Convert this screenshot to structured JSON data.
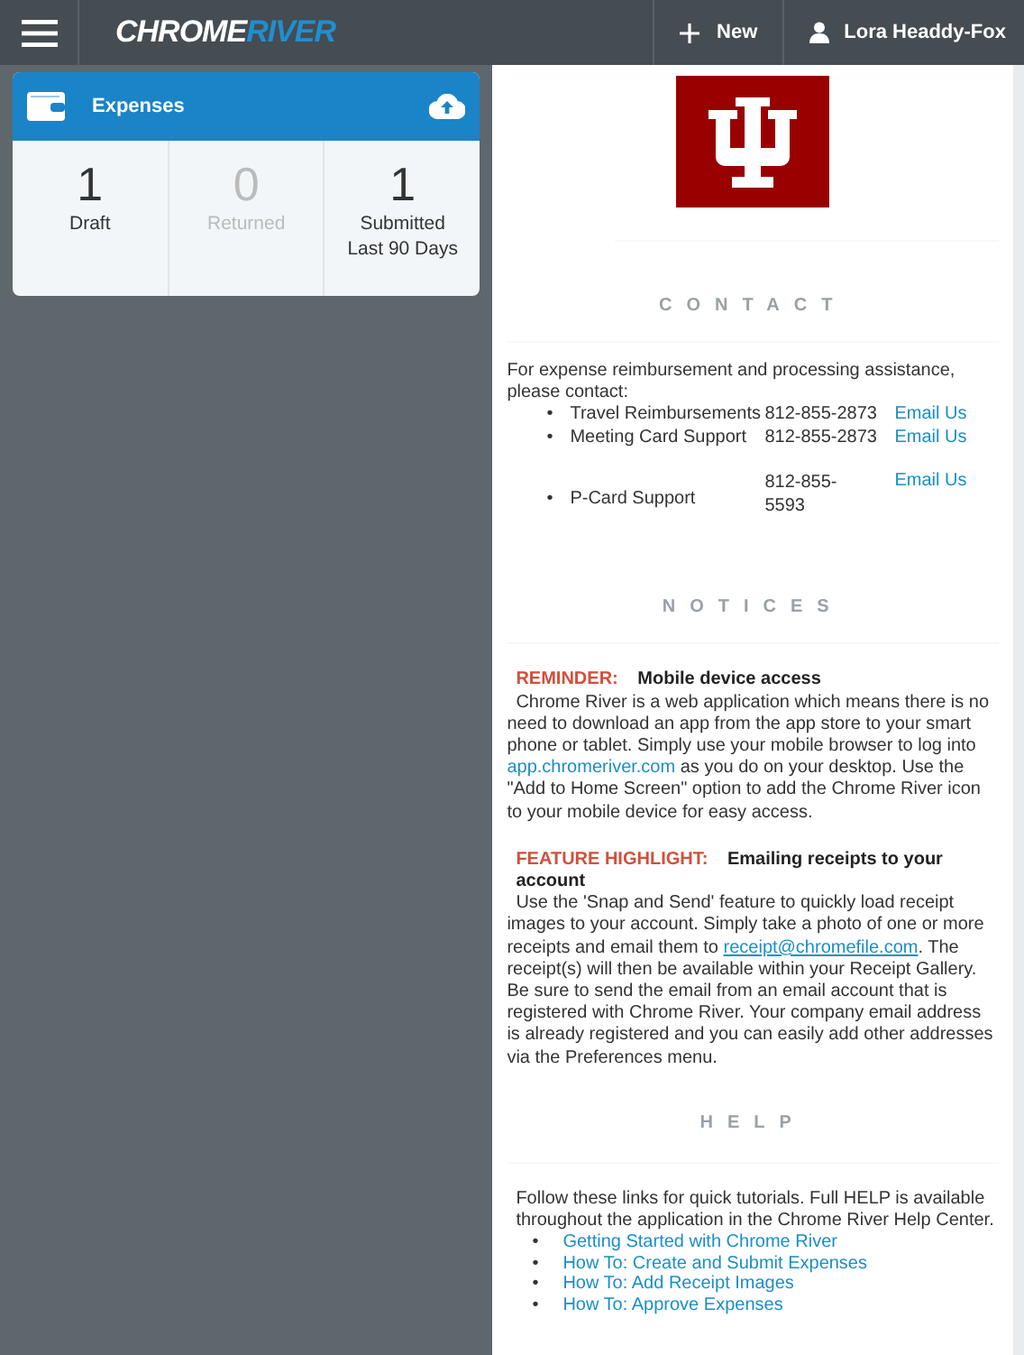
{
  "header": {
    "logo": {
      "part_1": "CHROME",
      "part_2": "RIVER"
    },
    "new_button": "New",
    "user": "Lora Headdy-Fox"
  },
  "expenses_card": {
    "title": "Expenses",
    "stats": [
      {
        "count": "1",
        "label": "Draft",
        "disabled": false
      },
      {
        "count": "0",
        "label": "Returned",
        "disabled": true
      },
      {
        "count": "1",
        "label": "Submitted Last 90 Days",
        "disabled": false
      }
    ]
  },
  "contact": {
    "heading": "CONTACT",
    "intro": "For expense reimbursement and processing assistance, please contact:",
    "items": [
      {
        "bullet": "•",
        "name": "Travel Reimbursements",
        "phone": "812-855-2873",
        "link": "Email Us"
      },
      {
        "bullet": "•",
        "name": "Meeting Card Support",
        "phone": "812-855-2873",
        "link": "Email Us"
      },
      {
        "bullet": "•",
        "name": "P-Card Support",
        "phone": "812-855-5593",
        "link": "Email Us"
      }
    ]
  },
  "notices": {
    "heading": "NOTICES",
    "items": [
      {
        "label": "REMINDER:",
        "title": "Mobile device access",
        "body_before": "Chrome River is a web application which means there is no need to download an app from the app store to your smart phone or tablet. Simply use your mobile browser to log into",
        "link": "app.chromeriver.com",
        "body_after": "as you do on your desktop. Use the \"Add to Home Screen\" option to add the Chrome River icon to your mobile device for easy access."
      },
      {
        "label": "FEATURE HIGHLIGHT:",
        "title": "Emailing receipts to your account",
        "body_before": "Use the 'Snap and Send' feature to quickly load receipt images to your account. Simply take a photo of one or more receipts and email them to",
        "link": "receipt@chromefile.com",
        "body_after": ". The receipt(s) will then be available within your Receipt Gallery. Be sure to send the email from an email account that is registered with Chrome River. Your company email address is already registered and you can easily add other addresses via the Preferences menu."
      }
    ]
  },
  "help": {
    "heading": "HELP",
    "intro": "Follow these links for quick tutorials. Full HELP is available throughout the application in the Chrome River Help Center.",
    "links": [
      {
        "bullet": "•",
        "text": "Getting Started with Chrome River"
      },
      {
        "bullet": "•",
        "text": "How To: Create and Submit Expenses"
      },
      {
        "bullet": "•",
        "text": "How To: Add Receipt Images"
      },
      {
        "bullet": "•",
        "text": "How To: Approve Expenses"
      }
    ]
  }
}
